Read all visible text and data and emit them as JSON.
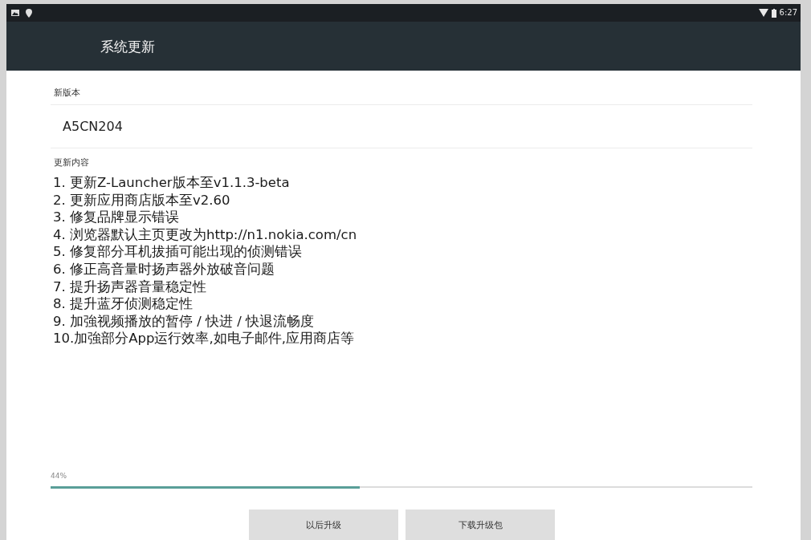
{
  "status_bar": {
    "time": "6:27"
  },
  "app_bar": {
    "title": "系统更新"
  },
  "new_version": {
    "label": "新版本",
    "value": "A5CN204"
  },
  "changelog": {
    "label": "更新内容",
    "items": [
      "1. 更新Z-Launcher版本至v1.1.3-beta",
      "2. 更新应用商店版本至v2.60",
      "3. 修复品牌显示错误",
      "4. 浏览器默认主页更改为http://n1.nokia.com/cn",
      "5. 修复部分耳机拔插可能出现的侦测错误",
      "6. 修正高音量时扬声器外放破音问题",
      "7. 提升扬声器音量稳定性",
      "8. 提升蓝牙侦测稳定性",
      "9. 加強视频播放的暂停 / 快进 / 快退流畅度",
      "10.加強部分App运行效率,如电子邮件,应用商店等"
    ]
  },
  "progress": {
    "reading": "44%",
    "level": 0.44
  },
  "buttons": [
    {
      "label": "以后升级"
    },
    {
      "label": "下载升级包"
    }
  ]
}
